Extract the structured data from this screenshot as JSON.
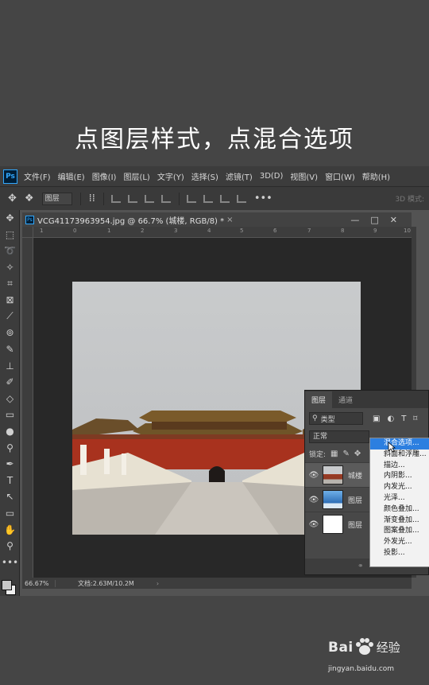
{
  "caption": "点图层样式，点混合选项",
  "menubar": {
    "logo": "Ps",
    "items": [
      "文件(F)",
      "编辑(E)",
      "图像(I)",
      "图层(L)",
      "文字(Y)",
      "选择(S)",
      "滤镜(T)",
      "3D(D)",
      "视图(V)",
      "窗口(W)",
      "帮助(H)"
    ]
  },
  "options_bar": {
    "auto_select_value": "图层",
    "three_d_label": "3D 模式:"
  },
  "tools": [
    "move-tool",
    "marquee-tool",
    "lasso-tool",
    "magic-wand-tool",
    "crop-tool",
    "frame-tool",
    "eyedropper-tool",
    "healing-tool",
    "brush-tool",
    "clone-stamp-tool",
    "history-brush-tool",
    "eraser-tool",
    "gradient-tool",
    "blur-tool",
    "dodge-tool",
    "pen-tool",
    "type-tool",
    "path-select-tool",
    "rectangle-tool",
    "hand-tool",
    "zoom-tool",
    "more-tools"
  ],
  "document": {
    "tab_title": "VCG41173963954.jpg @ 66.7% (城楼, RGB/8) *",
    "ruler_ticks": [
      "1",
      "0",
      "1",
      "2",
      "3",
      "4",
      "5",
      "6",
      "7",
      "8",
      "9",
      "10",
      "11"
    ]
  },
  "statusbar": {
    "zoom": "66.67%",
    "doc_size": "文档:2.63M/10.2M"
  },
  "layers_panel": {
    "tabs": [
      "图层",
      "通道"
    ],
    "filter_label": "类型",
    "blend_mode": "正常",
    "lock_label": "锁定:",
    "layers": [
      {
        "name": "城楼",
        "selected": true
      },
      {
        "name": "图层",
        "selected": false
      },
      {
        "name": "图层",
        "selected": false
      }
    ]
  },
  "context_menu": {
    "items": [
      "混合选项...",
      "斜面和浮雕...",
      "描边...",
      "内阴影...",
      "内发光...",
      "光泽...",
      "颜色叠加...",
      "渐变叠加...",
      "图案叠加...",
      "外发光...",
      "投影..."
    ],
    "highlighted_index": 0
  },
  "watermark": {
    "brand": "Bai",
    "brand_tail": "经验",
    "url": "jingyan.baidu.com"
  },
  "colors": {
    "accent": "#2c7fe0",
    "app_bg": "#535353",
    "canvas_bg": "#282828"
  }
}
